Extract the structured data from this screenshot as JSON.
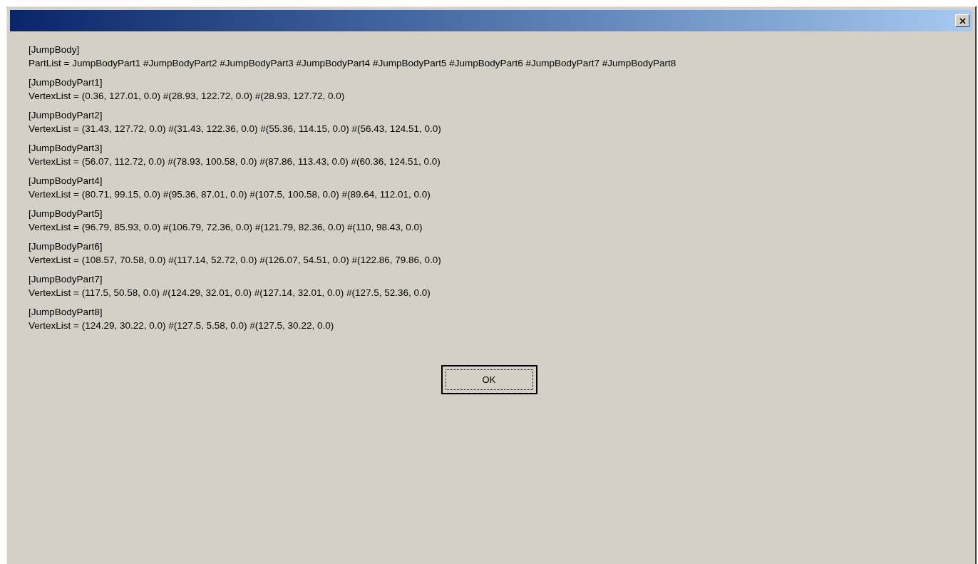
{
  "sections": [
    {
      "header": "[JumpBody]",
      "line": "PartList = JumpBodyPart1 #JumpBodyPart2 #JumpBodyPart3 #JumpBodyPart4 #JumpBodyPart5 #JumpBodyPart6 #JumpBodyPart7 #JumpBodyPart8"
    },
    {
      "header": "[JumpBodyPart1]",
      "line": "VertexList = (0.36, 127.01, 0.0) #(28.93, 122.72, 0.0) #(28.93, 127.72, 0.0)"
    },
    {
      "header": "[JumpBodyPart2]",
      "line": "VertexList = (31.43, 127.72, 0.0) #(31.43, 122.36, 0.0) #(55.36, 114.15, 0.0) #(56.43, 124.51, 0.0)"
    },
    {
      "header": "[JumpBodyPart3]",
      "line": "VertexList = (56.07, 112.72, 0.0) #(78.93, 100.58, 0.0) #(87.86, 113.43, 0.0) #(60.36, 124.51, 0.0)"
    },
    {
      "header": "[JumpBodyPart4]",
      "line": "VertexList = (80.71, 99.15, 0.0) #(95.36, 87.01, 0.0) #(107.5, 100.58, 0.0) #(89.64, 112.01, 0.0)"
    },
    {
      "header": "[JumpBodyPart5]",
      "line": "VertexList = (96.79, 85.93, 0.0) #(106.79, 72.36, 0.0) #(121.79, 82.36, 0.0) #(110, 98.43, 0.0)"
    },
    {
      "header": "[JumpBodyPart6]",
      "line": "VertexList = (108.57, 70.58, 0.0) #(117.14, 52.72, 0.0) #(126.07, 54.51, 0.0) #(122.86, 79.86, 0.0)"
    },
    {
      "header": "[JumpBodyPart7]",
      "line": "VertexList = (117.5, 50.58, 0.0) #(124.29, 32.01, 0.0) #(127.14, 32.01, 0.0) #(127.5, 52.36, 0.0)"
    },
    {
      "header": "[JumpBodyPart8]",
      "line": "VertexList = (124.29, 30.22, 0.0) #(127.5, 5.58, 0.0) #(127.5, 30.22, 0.0)"
    }
  ],
  "button": "OK"
}
